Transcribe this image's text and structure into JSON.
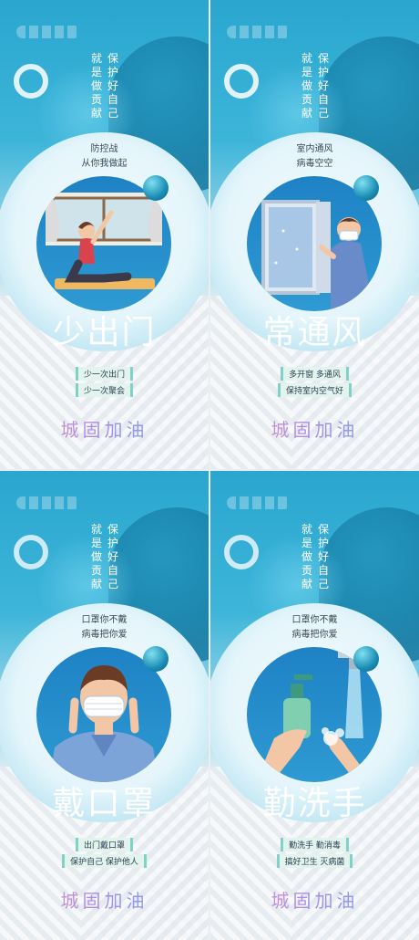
{
  "panels": [
    {
      "slogan_col1": "就是做贡献",
      "slogan_col2": "保护好自己",
      "sub_line1": "防控战",
      "sub_line2": "从你我做起",
      "title": "少出门",
      "tag1": "少一次出门",
      "tag2": "少一次聚会",
      "brand": "城固加油",
      "illustration": "woman-exercising-yoga-by-window"
    },
    {
      "slogan_col1": "就是做贡献",
      "slogan_col2": "保护好自己",
      "sub_line1": "室内通风",
      "sub_line2": "病毒空空",
      "title": "常通风",
      "tag1": "多开窗 多通风",
      "tag2": "保持室内空气好",
      "brand": "城固加油",
      "illustration": "man-with-mask-opening-window"
    },
    {
      "slogan_col1": "就是做贡献",
      "slogan_col2": "保护好自己",
      "sub_line1": "口罩你不戴",
      "sub_line2": "病毒把你爱",
      "title": "戴口罩",
      "tag1": "出门戴口罩",
      "tag2": "保护自己 保护他人",
      "brand": "城固加油",
      "illustration": "man-putting-on-mask"
    },
    {
      "slogan_col1": "就是做贡献",
      "slogan_col2": "保护好自己",
      "sub_line1": "口罩你不戴",
      "sub_line2": "病毒把你爱",
      "title": "勤洗手",
      "tag1": "勤洗手 勤消毒",
      "tag2": "搞好卫生 灭病菌",
      "brand": "城固加油",
      "illustration": "hands-washing-with-soap-and-faucet"
    }
  ]
}
